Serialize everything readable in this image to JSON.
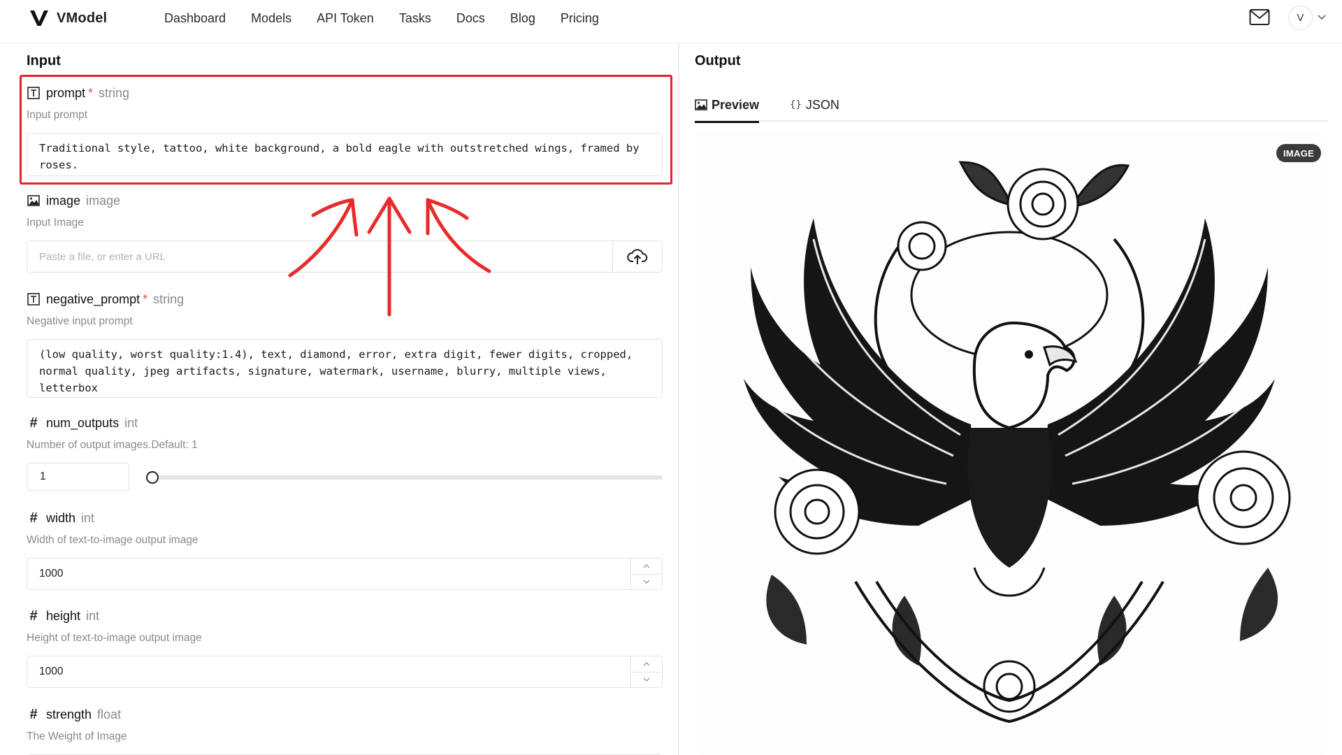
{
  "app": {
    "name": "VModel"
  },
  "nav": {
    "items": [
      "Dashboard",
      "Models",
      "API Token",
      "Tasks",
      "Docs",
      "Blog",
      "Pricing"
    ]
  },
  "user": {
    "avatar_letter": "V"
  },
  "input": {
    "title": "Input",
    "prompt": {
      "name": "prompt",
      "required": "*",
      "type": "string",
      "description": "Input prompt",
      "value": "Traditional style, tattoo, white background, a bold eagle with outstretched wings, framed by roses."
    },
    "image": {
      "name": "image",
      "type": "image",
      "description": "Input Image",
      "placeholder": "Paste a file, or enter a URL"
    },
    "negative_prompt": {
      "name": "negative_prompt",
      "required": "*",
      "type": "string",
      "description": "Negative input prompt",
      "value": "(low quality, worst quality:1.4), text, diamond, error, extra digit, fewer digits, cropped, normal quality, jpeg artifacts, signature, watermark, username, blurry, multiple views, letterbox"
    },
    "num_outputs": {
      "name": "num_outputs",
      "type": "int",
      "description": "Number of output images.Default: 1",
      "value": "1",
      "slider_fraction": 0
    },
    "width": {
      "name": "width",
      "type": "int",
      "description": "Width of text-to-image output image",
      "value": "1000"
    },
    "height": {
      "name": "height",
      "type": "int",
      "description": "Height of text-to-image output image",
      "value": "1000"
    },
    "strength": {
      "name": "strength",
      "type": "float",
      "description": "The Weight of Image"
    }
  },
  "output": {
    "title": "Output",
    "tabs": [
      "Preview",
      "JSON"
    ],
    "active_tab": "Preview",
    "badge": "IMAGE"
  },
  "colors": {
    "highlight": "#e8222b",
    "required": "#e5484d",
    "accent": "#111111"
  }
}
